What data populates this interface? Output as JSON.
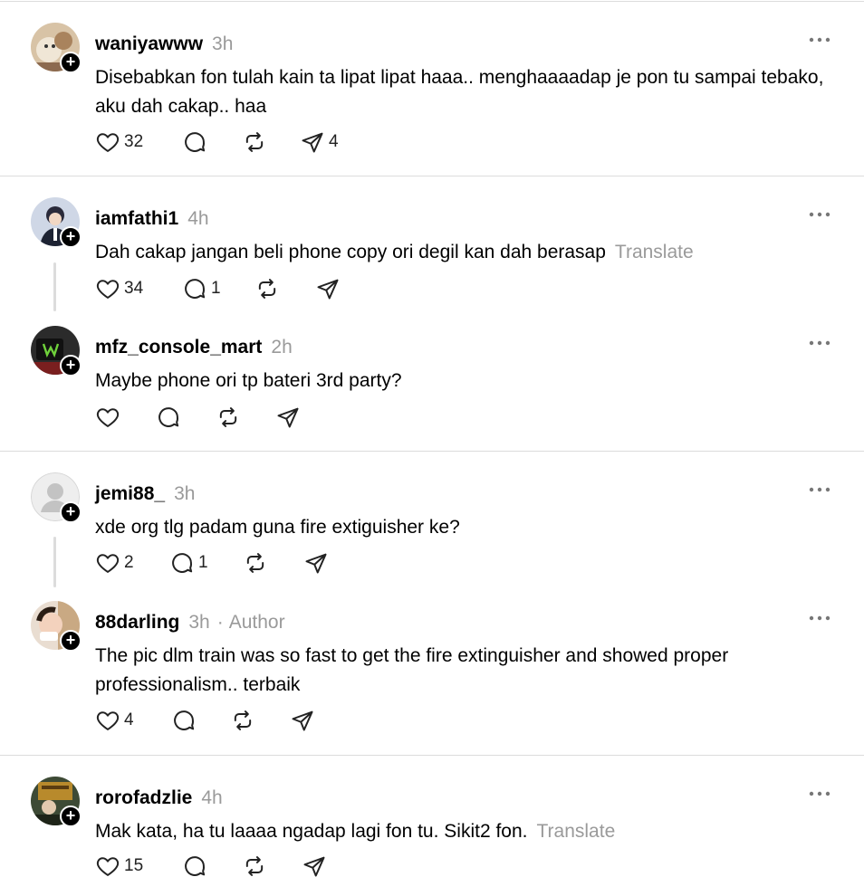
{
  "posts": [
    {
      "username": "waniyawww",
      "time": "3h",
      "text": "Disebabkan fon tulah kain ta lipat lipat haaa.. menghaaaadap je pon tu sampai tebako, aku dah cakap.. haa",
      "likes": "32",
      "replies": "",
      "shares": "4",
      "translate": ""
    },
    {
      "username": "iamfathi1",
      "time": "4h",
      "text": "Dah cakap jangan beli phone copy ori degil kan dah berasap",
      "likes": "34",
      "replies": "1",
      "shares": "",
      "translate": "Translate"
    },
    {
      "username": "mfz_console_mart",
      "time": "2h",
      "text": "Maybe phone ori tp bateri 3rd party?",
      "likes": "",
      "replies": "",
      "shares": "",
      "translate": ""
    },
    {
      "username": "jemi88_",
      "time": "3h",
      "text": "xde org tlg padam guna fire extiguisher ke?",
      "likes": "2",
      "replies": "1",
      "shares": "",
      "translate": ""
    },
    {
      "username": "88darling",
      "time": "3h",
      "author": "Author",
      "text": "The pic dlm train was so fast to get the fire extinguisher and showed proper professionalism.. terbaik",
      "likes": "4",
      "replies": "",
      "shares": "",
      "translate": ""
    },
    {
      "username": "rorofadzlie",
      "time": "4h",
      "text": "Mak kata, ha tu laaaa ngadap lagi fon tu. Sikit2 fon.",
      "likes": "15",
      "replies": "",
      "shares": "",
      "translate": "Translate"
    }
  ],
  "icons": {
    "like": "heart-icon",
    "reply": "comment-icon",
    "repost": "repost-icon",
    "share": "send-icon",
    "more": "more-icon",
    "follow": "follow-plus-icon"
  },
  "colors": {
    "muted": "#9a9a9a",
    "divider": "#dcdcdc",
    "text": "#000000"
  }
}
